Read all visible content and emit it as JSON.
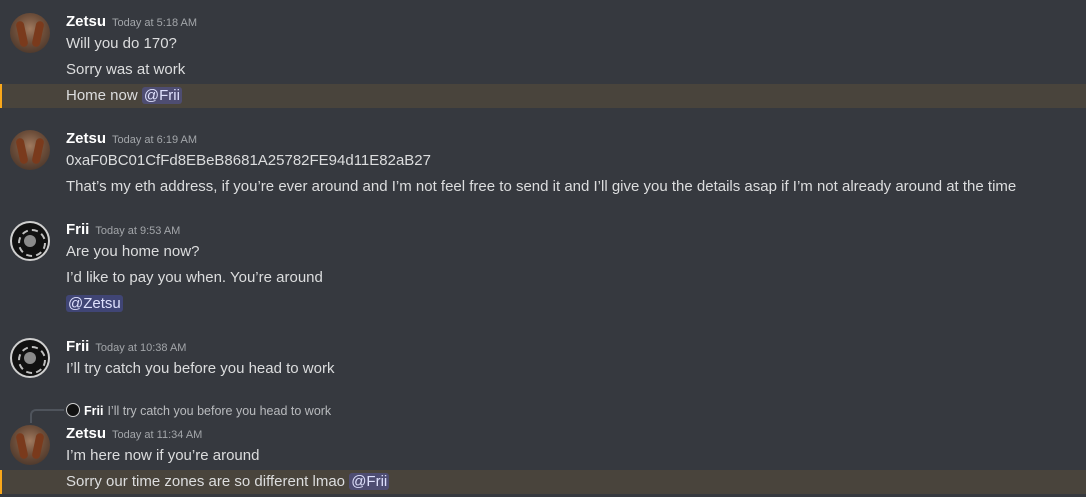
{
  "messages": [
    {
      "author": "Zetsu",
      "timestamp": "Today at 5:18 AM",
      "lines": [
        {
          "text": "Will you do 170?"
        },
        {
          "text": "Sorry was at work"
        },
        {
          "text": "Home now ",
          "mention": "@Frii"
        }
      ]
    },
    {
      "author": "Zetsu",
      "timestamp": "Today at 6:19 AM",
      "lines": [
        {
          "text": "0xaF0BC01CfFd8EBeB8681A25782FE94d11E82aB27"
        },
        {
          "text": "That’s my eth address, if you’re ever around and I’m not feel free to send it and I’ll give you the details asap if I’m not already around at the time"
        }
      ]
    },
    {
      "author": "Frii",
      "timestamp": "Today at 9:53 AM",
      "lines": [
        {
          "text": "Are you home now?"
        },
        {
          "text": "I’d like to pay you when. You’re around"
        },
        {
          "mention": "@Zetsu"
        }
      ]
    },
    {
      "author": "Frii",
      "timestamp": "Today at 10:38 AM",
      "lines": [
        {
          "text": "I’ll try catch you before you head to work"
        }
      ]
    },
    {
      "reply_to": {
        "author": "Frii",
        "text": "I’ll try catch you before you head to work"
      },
      "author": "Zetsu",
      "timestamp": "Today at 11:34 AM",
      "lines": [
        {
          "text": "I’m here now if you’re around"
        },
        {
          "text": "Sorry our time zones are so different lmao ",
          "mention": "@Frii"
        }
      ]
    }
  ],
  "colors": {
    "background": "#36393f",
    "highlight": "#49443c",
    "mention_bg": "#4a4f8a",
    "timestamp": "#a3a6aa"
  }
}
